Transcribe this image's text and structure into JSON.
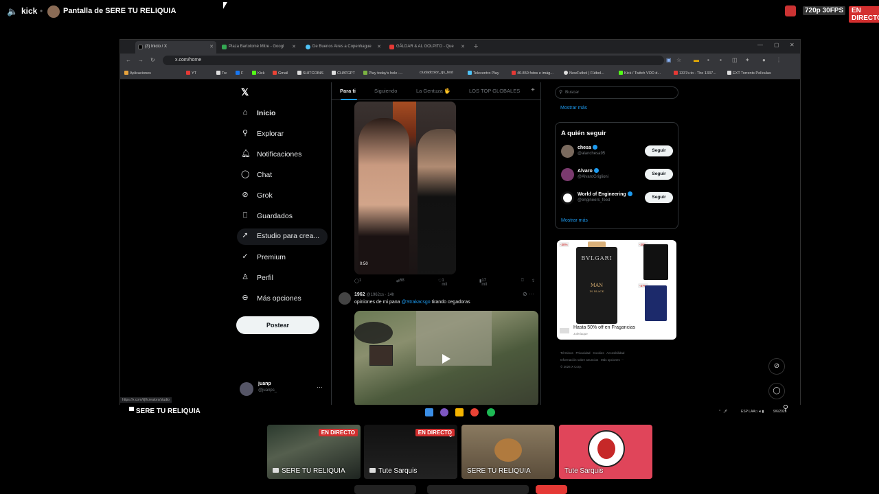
{
  "stream": {
    "platform": "kick",
    "title": "Pantalla de SERE TU RELIQUIA",
    "quality": "720p 30FPS",
    "live": "EN DIRECTO"
  },
  "browser": {
    "tabs": [
      "(3) Inicio / X",
      "Plaza Bartolomé Mitre - Googl",
      "De Buenos Aires a Copenhague",
      "GÁLDAR & AL GOLPITO - Que"
    ],
    "url": "x.com/home",
    "bookmarks": [
      "Aplicaciones",
      "YT",
      "Tw",
      "F",
      "Kick",
      "Gmail",
      "SHITCOINS",
      "CHATGPT",
      "Play today's hole -...",
      "ciudadcolor_qs_test",
      "Telecentro Play",
      "40.850 fotos e imág...",
      "NewFutbol | Fútbol...",
      "Kick / Twitch VOD d...",
      "1337x.to - The 1337...",
      "EXT Torrents Películas"
    ],
    "status_url": "https://x.com/i/jf/creators/studio"
  },
  "x": {
    "nav": [
      {
        "label": "Inicio",
        "icon": "home-icon"
      },
      {
        "label": "Explorar",
        "icon": "search-icon"
      },
      {
        "label": "Notificaciones",
        "icon": "bell-icon"
      },
      {
        "label": "Chat",
        "icon": "chat-icon"
      },
      {
        "label": "Grok",
        "icon": "grok-icon"
      },
      {
        "label": "Guardados",
        "icon": "bookmark-icon"
      },
      {
        "label": "Estudio para crea...",
        "icon": "rocket-icon"
      },
      {
        "label": "Premium",
        "icon": "premium-icon"
      },
      {
        "label": "Perfil",
        "icon": "person-icon"
      },
      {
        "label": "Más opciones",
        "icon": "more-circle-icon"
      }
    ],
    "post_button": "Postear",
    "user": {
      "name": "juanp",
      "handle": "@juanps_"
    },
    "timeline_tabs": [
      "Para ti",
      "Siguiendo",
      "La Gentuza 🖐",
      "LOS TOP GLOBALES"
    ],
    "tweet1": {
      "duration": "0:50",
      "replies": "1",
      "reposts": "68",
      "likes": "1 mil",
      "views": "17 mil"
    },
    "tweet2": {
      "name": "1962",
      "meta": "@1962cs · 14h",
      "text_before": "opiniones de mi pana ",
      "mention": "@Strakacsgo",
      "text_after": " tirando cegadoras"
    },
    "search_placeholder": "Buscar",
    "show_more": "Mostrar más",
    "who_to_follow": "A quién seguir",
    "follow_button": "Seguir",
    "suggestions": [
      {
        "name": "chesa",
        "handle": "@alanchesa95"
      },
      {
        "name": "Alvaro",
        "handle": "@AlvaroGriglioni"
      },
      {
        "name": "World of Engineering",
        "handle": "@engineers_feed"
      }
    ],
    "ad": {
      "brand": "BVLGARI",
      "product": "MAN",
      "product_sub": "IN BLACK",
      "caption": "Hasta 50% off en Fragancias",
      "sub": "Juleriaque",
      "discounts": [
        "-30%",
        "-30%",
        "-47%"
      ]
    },
    "footer": [
      "Términos",
      "Privacidad",
      "Cookies",
      "Accesibilidad",
      "Información sobre anuncios",
      "Más opciones ···",
      "© 2026 X Corp."
    ]
  },
  "taskbar": {
    "window_label": "SERE TU RELIQUIA",
    "lang": "ESP LAA",
    "date": "9/6/2026"
  },
  "participants": [
    {
      "name": "SERE TU RELIQUIA",
      "badge": "EN DIRECTO"
    },
    {
      "name": "Tute Sarquis",
      "badge": "EN DIRECTO"
    },
    {
      "name": "SERE TU RELIQUIA",
      "badge": ""
    },
    {
      "name": "Tute Sarquis",
      "badge": ""
    }
  ]
}
